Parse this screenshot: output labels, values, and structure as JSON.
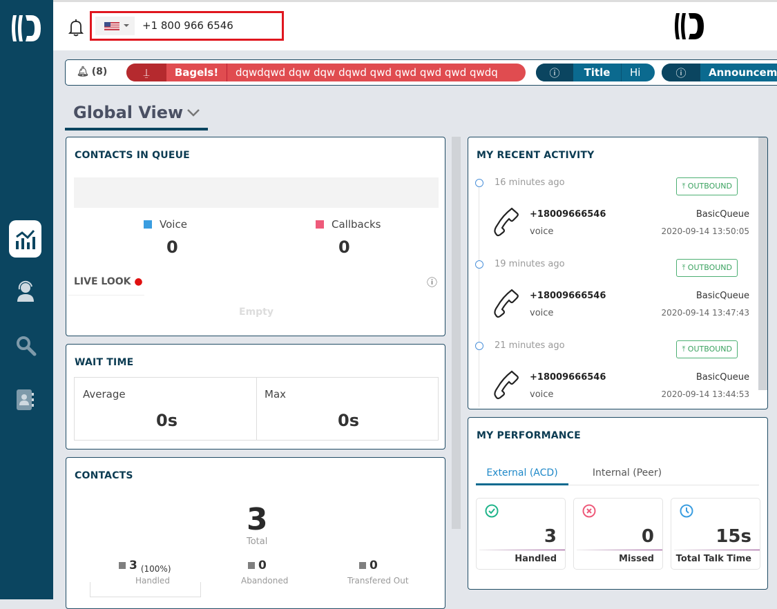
{
  "header": {
    "phone_number": "+1 800 966 6546",
    "country": "US"
  },
  "notifications": {
    "count": "(8)",
    "alert_title": "Bagels!",
    "alert_text": "dqwdqwd dqw dqw dqwd qwd qwd qwd qwd qwdq",
    "info_title": "Title",
    "info_text": "Hi",
    "announcement_title": "Announceme"
  },
  "view": {
    "title": "Global View"
  },
  "contacts_in_queue": {
    "title": "CONTACTS IN QUEUE",
    "voice_label": "Voice",
    "voice_value": "0",
    "callbacks_label": "Callbacks",
    "callbacks_value": "0",
    "voice_color": "#3a9de0",
    "callbacks_color": "#ee5a7a",
    "live_look": "LIVE LOOK",
    "empty": "Empty"
  },
  "wait_time": {
    "title": "WAIT TIME",
    "average_label": "Average",
    "average_value": "0s",
    "max_label": "Max",
    "max_value": "0s"
  },
  "contacts": {
    "title": "CONTACTS",
    "total": "3",
    "total_label": "Total",
    "handled": "3",
    "handled_pct": "(100%)",
    "handled_label": "Handled",
    "abandoned": "0",
    "abandoned_label": "Abandoned",
    "transferred": "0",
    "transferred_label": "Transfered Out"
  },
  "recent_activity": {
    "title": "MY RECENT ACTIVITY",
    "items": [
      {
        "time": "16 minutes ago",
        "direction": "OUTBOUND",
        "number": "+18009666546",
        "type": "voice",
        "queue": "BasicQueue",
        "datetime": "2020-09-14 13:50:05"
      },
      {
        "time": "19 minutes ago",
        "direction": "OUTBOUND",
        "number": "+18009666546",
        "type": "voice",
        "queue": "BasicQueue",
        "datetime": "2020-09-14 13:47:43"
      },
      {
        "time": "21 minutes ago",
        "direction": "OUTBOUND",
        "number": "+18009666546",
        "type": "voice",
        "queue": "BasicQueue",
        "datetime": "2020-09-14 13:44:53"
      }
    ]
  },
  "performance": {
    "title": "MY PERFORMANCE",
    "tabs": [
      "External (ACD)",
      "Internal (Peer)"
    ],
    "active_tab": 0,
    "stats": [
      {
        "value": "3",
        "label": "Handled",
        "icon": "check-circle-icon",
        "color": "#1fb48a"
      },
      {
        "value": "0",
        "label": "Missed",
        "icon": "x-circle-icon",
        "color": "#ee5a7a"
      },
      {
        "value": "15s",
        "label": "Total Talk Time",
        "icon": "clock-icon",
        "color": "#3a9de0"
      }
    ]
  },
  "colors": {
    "sidebar": "#0b4560",
    "alert": "#e04c50",
    "info": "#0b6a8f",
    "highlight": "#e0161e"
  }
}
